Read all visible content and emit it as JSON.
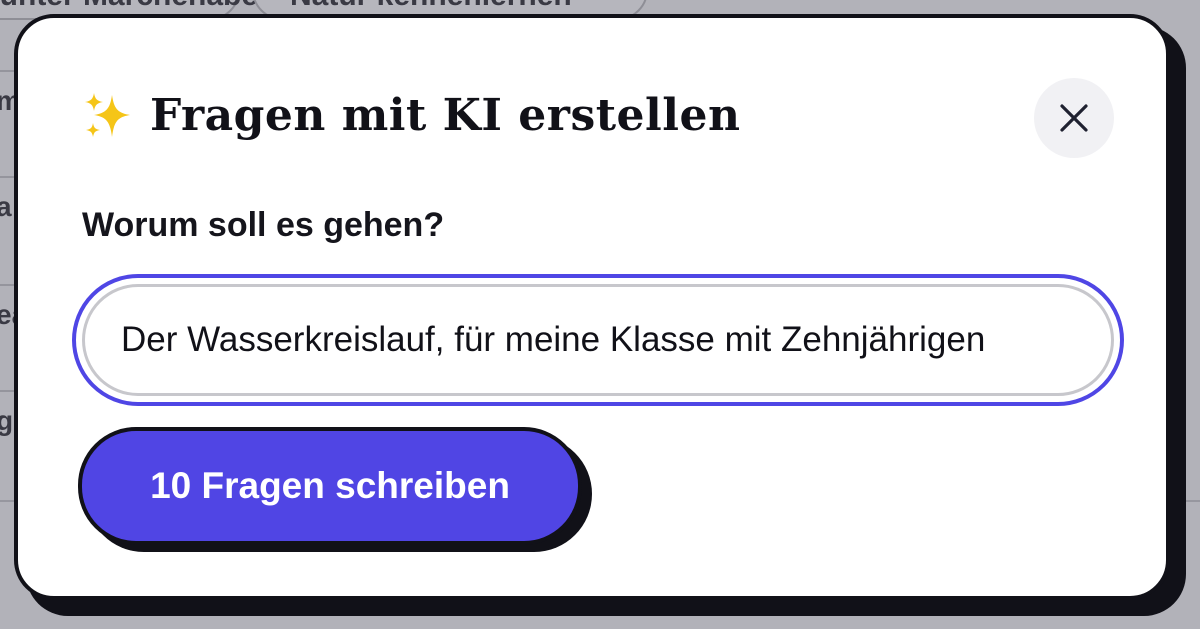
{
  "background": {
    "tabs": [
      "Bunter Märchenabend",
      "Natur kennenlernen"
    ],
    "row_fragments": [
      "m",
      "a",
      "ea",
      "g"
    ]
  },
  "modal": {
    "title_icon": "sparkles-icon",
    "title": "Fragen mit KI erstellen",
    "close_icon": "close-icon",
    "field_label": "Worum soll es gehen?",
    "topic_input_value": "Der Wasserkreislauf, für meine Klasse mit Zehnjährigen",
    "generate_button_label": "10 Fragen schreiben"
  },
  "colors": {
    "accent": "#4f46e5",
    "button": "#5045e4",
    "ink": "#111118",
    "backdrop": "#a3a3aa"
  }
}
